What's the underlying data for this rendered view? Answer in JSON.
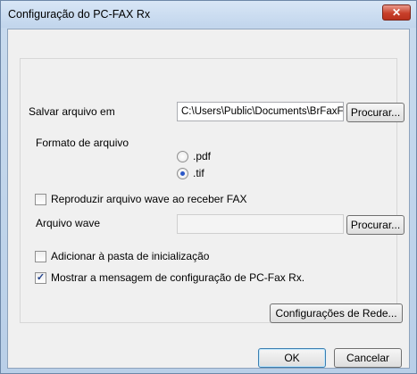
{
  "window": {
    "title": "Configuração do PC-FAX Rx",
    "close_glyph": "✕"
  },
  "form": {
    "save_to": {
      "label": "Salvar arquivo em",
      "value": "C:\\Users\\Public\\Documents\\BrFaxF",
      "browse_label": "Procurar..."
    },
    "file_format": {
      "label": "Formato de arquivo",
      "options": [
        {
          "label": ".pdf",
          "selected": false
        },
        {
          "label": ".tif",
          "selected": true
        }
      ]
    },
    "play_wave": {
      "label": "Reproduzir arquivo wave ao receber FAX",
      "checked": false
    },
    "wave_file": {
      "label": "Arquivo wave",
      "value": "",
      "browse_label": "Procurar..."
    },
    "add_startup": {
      "label": "Adicionar à pasta de inicialização",
      "checked": false
    },
    "show_message": {
      "label": "Mostrar a mensagem de configuração de PC-Fax Rx.",
      "checked": true
    },
    "network_settings_label": "Configurações de Rede..."
  },
  "footer": {
    "ok_label": "OK",
    "cancel_label": "Cancelar"
  }
}
